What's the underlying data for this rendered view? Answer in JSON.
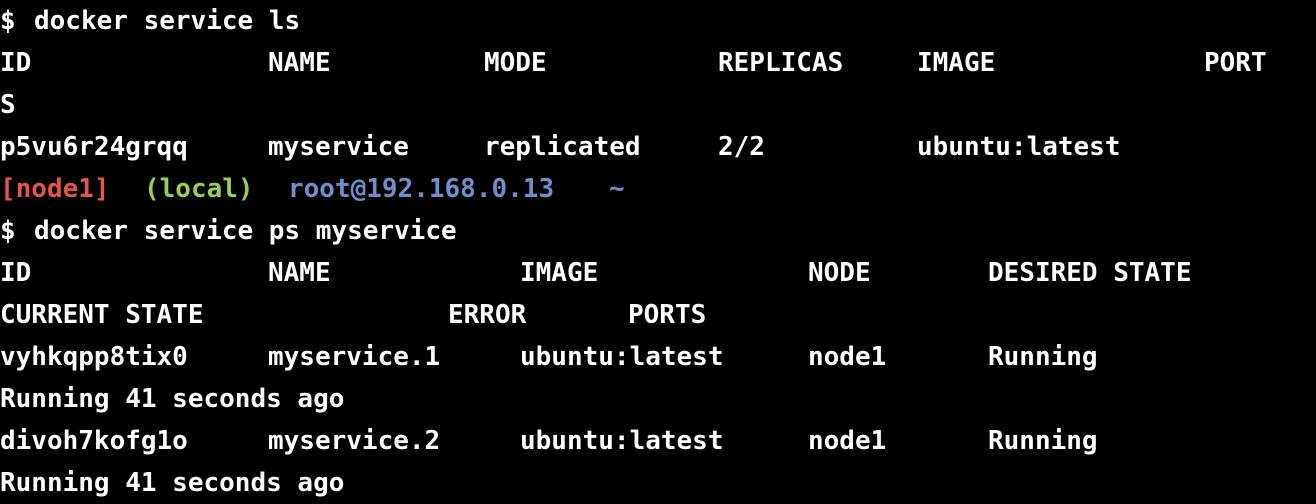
{
  "colors": {
    "background": "#000000",
    "text": "#ffffff",
    "node_label": "#e2574c",
    "local_label": "#9acd59",
    "user_host": "#6f8fc9"
  },
  "cmd1": {
    "prompt_symbol": "$",
    "command": "docker service ls"
  },
  "ls_headers": {
    "id": "ID",
    "name": "NAME",
    "mode": "MODE",
    "replicas": "REPLICAS",
    "image": "IMAGE",
    "ports_part1": "PORT",
    "ports_part2": "S"
  },
  "ls_rows": [
    {
      "id": "p5vu6r24grqq",
      "name": "myservice",
      "mode": "replicated",
      "replicas": "2/2",
      "image": "ubuntu:latest"
    }
  ],
  "prompt": {
    "node": "[node1]",
    "location": "(local)",
    "user_host": "root@192.168.0.13",
    "cwd": "~"
  },
  "cmd2": {
    "prompt_symbol": "$",
    "command": "docker service ps myservice"
  },
  "ps_headers": {
    "id": "ID",
    "name": "NAME",
    "image": "IMAGE",
    "node": "NODE",
    "desired_state": "DESIRED STATE",
    "current_state": "CURRENT STATE",
    "error": "ERROR",
    "ports": "PORTS"
  },
  "ps_rows": [
    {
      "id": "vyhkqpp8tix0",
      "name": "myservice.1",
      "image": "ubuntu:latest",
      "node": "node1",
      "desired_state": "Running",
      "current_state": "Running 41 seconds ago"
    },
    {
      "id": "divoh7kofg1o",
      "name": "myservice.2",
      "image": "ubuntu:latest",
      "node": "node1",
      "desired_state": "Running",
      "current_state": "Running 41 seconds ago"
    }
  ]
}
